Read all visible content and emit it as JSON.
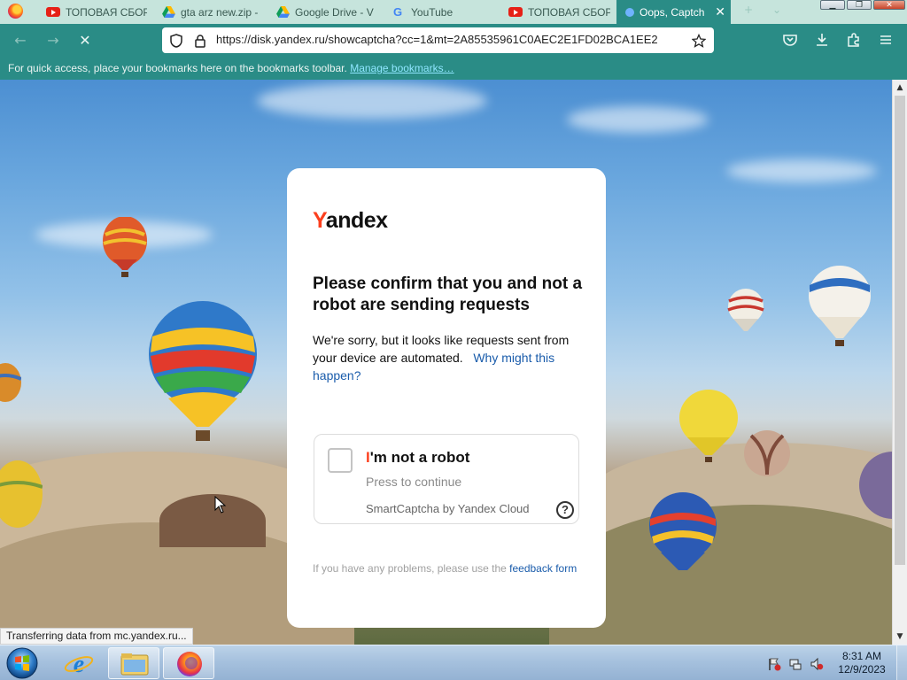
{
  "tabs": [
    {
      "title": "ТОПОВАЯ СБОР",
      "icon": "youtube-icon"
    },
    {
      "title": "gta arz new.zip -",
      "icon": "google-drive-icon"
    },
    {
      "title": "Google Drive - V",
      "icon": "google-drive-icon"
    },
    {
      "title": "YouTube",
      "icon": "google-icon"
    },
    {
      "title": "ТОПОВАЯ СБОР",
      "icon": "youtube-icon"
    },
    {
      "title": "Oops, Captch",
      "icon": "yandex-icon",
      "active": true
    }
  ],
  "navbar": {
    "url": "https://disk.yandex.ru/showcaptcha?cc=1&mt=2A85535961C0AEC2E1FD02BCA1EE2"
  },
  "bookmarks_bar": {
    "text": "For quick access, place your bookmarks here on the bookmarks toolbar.",
    "link": "Manage bookmarks…"
  },
  "captcha_page": {
    "logo_first": "Y",
    "logo_rest": "andex",
    "headline": "Please confirm that you and not a robot are sending requests",
    "body": "We're sorry, but it looks like requests sent from your device are automated.",
    "why_link": "Why might this happen?",
    "checkbox_label_first": "I",
    "checkbox_label_rest": "'m not a robot",
    "press_text": "Press to continue",
    "provider": "SmartCaptcha by Yandex Cloud",
    "help_symbol": "?",
    "footer_text": "If you have any problems, please use the",
    "footer_link": "feedback form"
  },
  "status_bar": {
    "text": "Transferring data from mc.yandex.ru..."
  },
  "taskbar": {
    "time": "8:31 AM",
    "date": "12/9/2023",
    "apps": [
      "internet-explorer",
      "windows-explorer",
      "firefox"
    ]
  },
  "colors": {
    "firefox_teal": "#2a8c86",
    "tabstrip": "#c6e4dc",
    "yandex_red": "#fc3f1d",
    "link_blue": "#1a5cab"
  }
}
